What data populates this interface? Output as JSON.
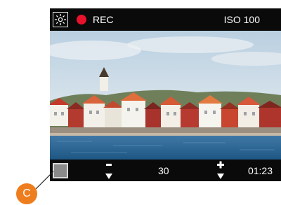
{
  "top_bar": {
    "mode_icon": "sun-icon",
    "record_indicator_color": "#e8132b",
    "record_label": "REC",
    "iso_label": "ISO 100"
  },
  "viewfinder": {
    "scene": "harbour-village-photo"
  },
  "bottom_bar": {
    "thumbnail": "last-shot-thumbnail",
    "decrease_icon": "minus-icon",
    "value": "30",
    "increase_icon": "plus-icon",
    "time": "01:23"
  },
  "callout": {
    "letter": "C",
    "color": "#ee7d1e"
  }
}
